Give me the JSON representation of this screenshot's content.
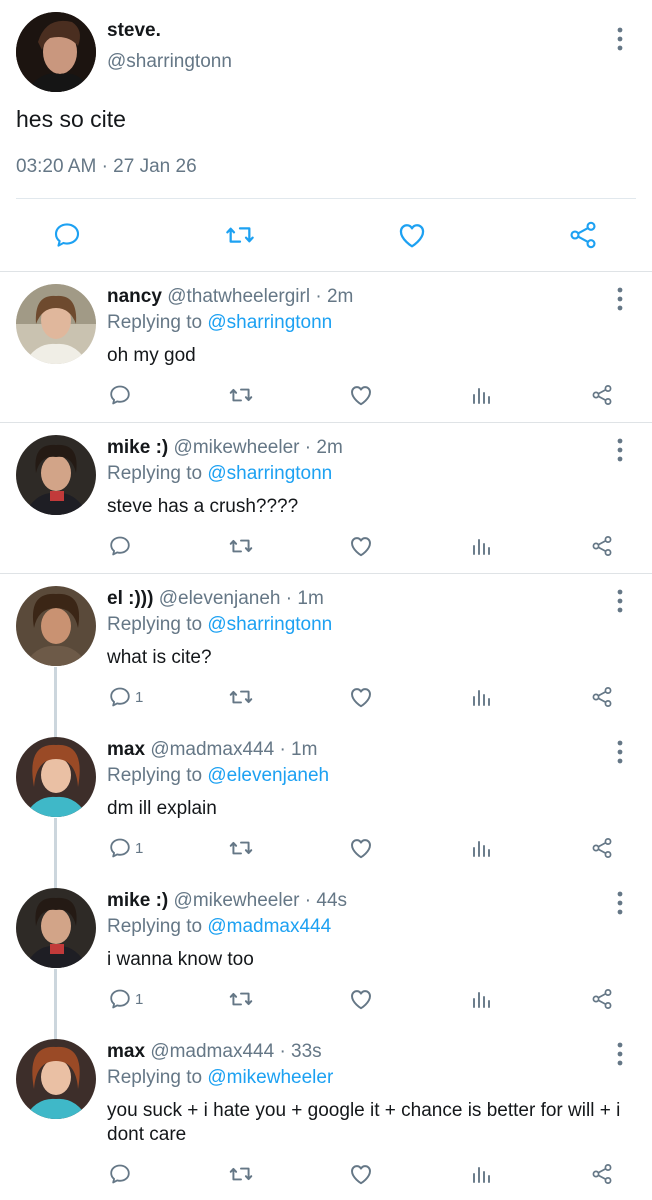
{
  "main_tweet": {
    "name": "steve.",
    "handle": "@sharringtonn",
    "text": "hes so cite",
    "time": "03:20 AM",
    "separator": "·",
    "date": "27 Jan 26"
  },
  "replies": [
    {
      "name": "nancy",
      "handle": "@thatwheelergirl",
      "separator": "·",
      "time": "2m",
      "replying_prefix": "Replying to ",
      "replying_to": "@sharringtonn",
      "text": "oh my god",
      "reply_count": ""
    },
    {
      "name": "mike :)",
      "handle": "@mikewheeler",
      "separator": "·",
      "time": "2m",
      "replying_prefix": "Replying to ",
      "replying_to": "@sharringtonn",
      "text": "steve has a crush????",
      "reply_count": ""
    },
    {
      "name": "el :)))",
      "handle": "@elevenjaneh",
      "separator": "·",
      "time": "1m",
      "replying_prefix": "Replying to ",
      "replying_to": "@sharringtonn",
      "text": "what is cite?",
      "reply_count": "1"
    },
    {
      "name": "max",
      "handle": "@madmax444",
      "separator": "·",
      "time": "1m",
      "replying_prefix": "Replying to ",
      "replying_to": "@elevenjaneh",
      "text": "dm ill explain",
      "reply_count": "1"
    },
    {
      "name": "mike :)",
      "handle": "@mikewheeler",
      "separator": "·",
      "time": "44s",
      "replying_prefix": "Replying to ",
      "replying_to": "@madmax444",
      "text": "i wanna know too",
      "reply_count": "1"
    },
    {
      "name": "max",
      "handle": "@madmax444",
      "separator": "·",
      "time": "33s",
      "replying_prefix": "Replying to ",
      "replying_to": "@mikewheeler",
      "text": "you suck + i hate you + google it + chance is better for will + i dont care",
      "reply_count": ""
    }
  ],
  "icons": {
    "reply": "reply-icon",
    "retweet": "retweet-icon",
    "like": "heart-icon",
    "analytics": "analytics-icon",
    "share": "share-icon",
    "more": "more-vertical-icon"
  },
  "colors": {
    "link": "#1da1f2",
    "secondary_text": "#657786",
    "primary_text": "#14171a",
    "icon_main": "#1da1f2",
    "icon_reply": "#657786"
  }
}
